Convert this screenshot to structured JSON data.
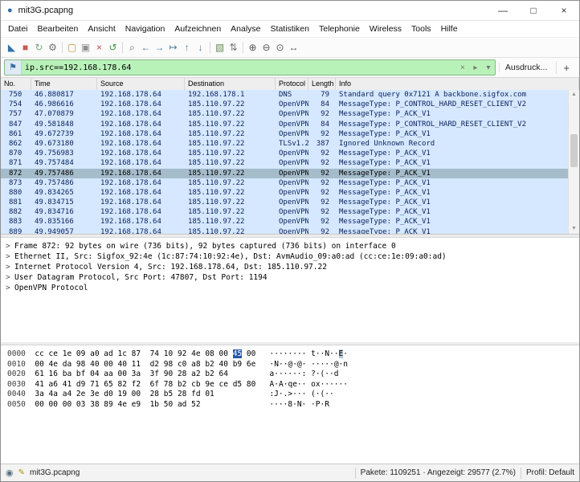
{
  "window": {
    "title": "mit3G.pcapng",
    "app_icon_glyph": "●",
    "minimize_glyph": "—",
    "maximize_glyph": "□",
    "close_glyph": "×"
  },
  "menu": {
    "items": [
      "Datei",
      "Bearbeiten",
      "Ansicht",
      "Navigation",
      "Aufzeichnen",
      "Analyse",
      "Statistiken",
      "Telephonie",
      "Wireless",
      "Tools",
      "Hilfe"
    ]
  },
  "toolbar": {
    "icons": [
      {
        "name": "start-capture-icon",
        "glyph": "◣",
        "color": "#3272a8"
      },
      {
        "name": "stop-capture-icon",
        "glyph": "■",
        "color": "#c85a55"
      },
      {
        "name": "restart-capture-icon",
        "glyph": "↻",
        "color": "#7fa47f"
      },
      {
        "name": "capture-options-icon",
        "glyph": "⚙",
        "color": "#6f6f6f"
      },
      {
        "sep": true
      },
      {
        "name": "open-file-icon",
        "glyph": "▢",
        "color": "#b98f3e"
      },
      {
        "name": "save-file-icon",
        "glyph": "▣",
        "color": "#8f8f8f"
      },
      {
        "name": "close-file-icon",
        "glyph": "×",
        "color": "#c05050"
      },
      {
        "name": "reload-file-icon",
        "glyph": "↺",
        "color": "#3b9c3b"
      },
      {
        "sep": true
      },
      {
        "name": "find-packet-icon",
        "glyph": "⌕",
        "color": "#5f5f5f"
      },
      {
        "name": "go-back-icon",
        "glyph": "←",
        "color": "#49799c"
      },
      {
        "name": "go-forward-icon",
        "glyph": "→",
        "color": "#49799c"
      },
      {
        "name": "go-to-packet-icon",
        "glyph": "↦",
        "color": "#49799c"
      },
      {
        "name": "go-first-icon",
        "glyph": "↑",
        "color": "#49799c"
      },
      {
        "name": "go-last-icon",
        "glyph": "↓",
        "color": "#49799c"
      },
      {
        "sep": true
      },
      {
        "name": "colorize-icon",
        "glyph": "▧",
        "color": "#6e8f56"
      },
      {
        "name": "auto-scroll-icon",
        "glyph": "⇅",
        "color": "#777777"
      },
      {
        "sep": true
      },
      {
        "name": "zoom-in-icon",
        "glyph": "⊕",
        "color": "#555555"
      },
      {
        "name": "zoom-out-icon",
        "glyph": "⊖",
        "color": "#555555"
      },
      {
        "name": "zoom-reset-icon",
        "glyph": "⊙",
        "color": "#555555"
      },
      {
        "name": "resize-columns-icon",
        "glyph": "↔",
        "color": "#555555"
      }
    ]
  },
  "filter": {
    "bookmark_glyph": "⚑",
    "value": "ip.src==192.168.178.64",
    "clear_glyph": "×",
    "apply_glyph": "▸",
    "dropdown_glyph": "▾",
    "expression_label": "Ausdruck...",
    "add_label": "+",
    "valid_color": "#b9f2b9"
  },
  "packet_list": {
    "columns": [
      "No.",
      "Time",
      "Source",
      "Destination",
      "Protocol",
      "Length",
      "Info"
    ],
    "row_color": "#d6e8ff",
    "selected_color": "#a5bccb",
    "rows": [
      {
        "no": "750",
        "time": "46.880817",
        "source": "192.168.178.64",
        "destination": "192.168.178.1",
        "protocol": "DNS",
        "length": "79",
        "info": "Standard query 0x7121 A backbone.sigfox.com",
        "selected": false
      },
      {
        "no": "754",
        "time": "46.986616",
        "source": "192.168.178.64",
        "destination": "185.110.97.22",
        "protocol": "OpenVPN",
        "length": "84",
        "info": "MessageType: P_CONTROL_HARD_RESET_CLIENT_V2",
        "selected": false
      },
      {
        "no": "757",
        "time": "47.070879",
        "source": "192.168.178.64",
        "destination": "185.110.97.22",
        "protocol": "OpenVPN",
        "length": "92",
        "info": "MessageType: P_ACK_V1",
        "selected": false
      },
      {
        "no": "847",
        "time": "49.581848",
        "source": "192.168.178.64",
        "destination": "185.110.97.22",
        "protocol": "OpenVPN",
        "length": "84",
        "info": "MessageType: P_CONTROL_HARD_RESET_CLIENT_V2",
        "selected": false
      },
      {
        "no": "861",
        "time": "49.672739",
        "source": "192.168.178.64",
        "destination": "185.110.97.22",
        "protocol": "OpenVPN",
        "length": "92",
        "info": "MessageType: P_ACK_V1",
        "selected": false
      },
      {
        "no": "862",
        "time": "49.673180",
        "source": "192.168.178.64",
        "destination": "185.110.97.22",
        "protocol": "TLSv1.2",
        "length": "387",
        "info": "Ignored Unknown Record",
        "selected": false
      },
      {
        "no": "870",
        "time": "49.756983",
        "source": "192.168.178.64",
        "destination": "185.110.97.22",
        "protocol": "OpenVPN",
        "length": "92",
        "info": "MessageType: P_ACK_V1",
        "selected": false
      },
      {
        "no": "871",
        "time": "49.757484",
        "source": "192.168.178.64",
        "destination": "185.110.97.22",
        "protocol": "OpenVPN",
        "length": "92",
        "info": "MessageType: P_ACK_V1",
        "selected": false
      },
      {
        "no": "872",
        "time": "49.757486",
        "source": "192.168.178.64",
        "destination": "185.110.97.22",
        "protocol": "OpenVPN",
        "length": "92",
        "info": "MessageType: P_ACK_V1",
        "selected": true
      },
      {
        "no": "873",
        "time": "49.757486",
        "source": "192.168.178.64",
        "destination": "185.110.97.22",
        "protocol": "OpenVPN",
        "length": "92",
        "info": "MessageType: P_ACK_V1",
        "selected": false
      },
      {
        "no": "880",
        "time": "49.834265",
        "source": "192.168.178.64",
        "destination": "185.110.97.22",
        "protocol": "OpenVPN",
        "length": "92",
        "info": "MessageType: P_ACK_V1",
        "selected": false
      },
      {
        "no": "881",
        "time": "49.834715",
        "source": "192.168.178.64",
        "destination": "185.110.97.22",
        "protocol": "OpenVPN",
        "length": "92",
        "info": "MessageType: P_ACK_V1",
        "selected": false
      },
      {
        "no": "882",
        "time": "49.834716",
        "source": "192.168.178.64",
        "destination": "185.110.97.22",
        "protocol": "OpenVPN",
        "length": "92",
        "info": "MessageType: P_ACK_V1",
        "selected": false
      },
      {
        "no": "883",
        "time": "49.835166",
        "source": "192.168.178.64",
        "destination": "185.110.97.22",
        "protocol": "OpenVPN",
        "length": "92",
        "info": "MessageType: P_ACK_V1",
        "selected": false
      },
      {
        "no": "889",
        "time": "49.949057",
        "source": "192.168.178.64",
        "destination": "185.110.97.22",
        "protocol": "OpenVPN",
        "length": "92",
        "info": "MessageType: P_ACK_V1",
        "selected": false
      }
    ]
  },
  "details": {
    "expander_glyph": ">",
    "lines": [
      "Frame 872: 92 bytes on wire (736 bits), 92 bytes captured (736 bits) on interface 0",
      "Ethernet II, Src: Sigfox_92:4e (1c:87:74:10:92:4e), Dst: AvmAudio_09:a0:ad (cc:ce:1e:09:a0:ad)",
      "Internet Protocol Version 4, Src: 192.168.178.64, Dst: 185.110.97.22",
      "User Datagram Protocol, Src Port: 47807, Dst Port: 1194",
      "OpenVPN Protocol"
    ]
  },
  "hex": {
    "highlight": {
      "row": 0,
      "byte": 14,
      "ascii": 14
    },
    "rows": [
      {
        "offset": "0000",
        "bytes": [
          "cc",
          "ce",
          "1e",
          "09",
          "a0",
          "ad",
          "1c",
          "87",
          "74",
          "10",
          "92",
          "4e",
          "08",
          "00",
          "45",
          "00"
        ],
        "ascii": "········t··N··E·"
      },
      {
        "offset": "0010",
        "bytes": [
          "00",
          "4e",
          "da",
          "98",
          "40",
          "00",
          "40",
          "11",
          "d2",
          "98",
          "c0",
          "a8",
          "b2",
          "40",
          "b9",
          "6e"
        ],
        "ascii": "·N··@·@······@·n"
      },
      {
        "offset": "0020",
        "bytes": [
          "61",
          "16",
          "ba",
          "bf",
          "04",
          "aa",
          "00",
          "3a",
          "3f",
          "90",
          "28",
          "a2",
          "b2",
          "64"
        ],
        "ascii": "a······:?·(··d"
      },
      {
        "offset": "0030",
        "bytes": [
          "41",
          "a6",
          "41",
          "d9",
          "71",
          "65",
          "82",
          "f2",
          "6f",
          "78",
          "b2",
          "cb",
          "9e",
          "ce",
          "d5",
          "80"
        ],
        "ascii": "A·A·qe··ox······"
      },
      {
        "offset": "0040",
        "bytes": [
          "3a",
          "4a",
          "a4",
          "2e",
          "3e",
          "d0",
          "19",
          "00",
          "28",
          "b5",
          "28",
          "fd",
          "01"
        ],
        "ascii": ":J·.>···(·(··"
      },
      {
        "offset": "0050",
        "bytes": [
          "00",
          "00",
          "00",
          "03",
          "38",
          "89",
          "4e",
          "e9",
          "1b",
          "50",
          "ad",
          "52"
        ],
        "ascii": "····8·N··P·R"
      }
    ]
  },
  "status": {
    "expert_glyph": "◉",
    "edit_glyph": "✎",
    "file": "mit3G.pcapng",
    "stats": "Pakete: 1109251 · Angezeigt: 29577 (2.7%)",
    "profile": "Profil: Default"
  },
  "scrollbar": {
    "up_glyph": "▲",
    "down_glyph": "▼"
  }
}
